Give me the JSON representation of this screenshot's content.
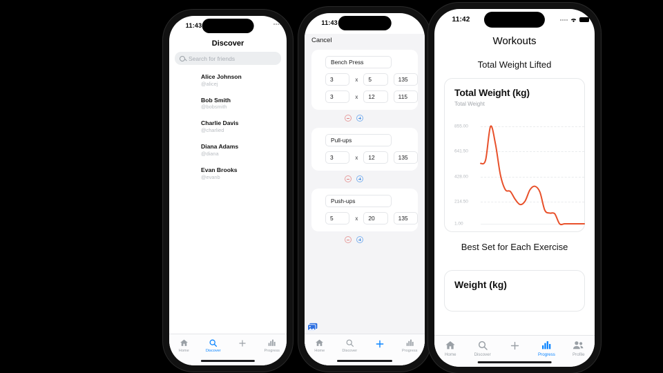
{
  "phones": {
    "discover": {
      "status": {
        "time": "11:43"
      },
      "nav_title": "Discover",
      "search": {
        "placeholder": "Search for friends",
        "icon": "search-icon"
      },
      "friends": [
        {
          "name": "Alice Johnson",
          "handle": "@alicej"
        },
        {
          "name": "Bob Smith",
          "handle": "@bobsmith"
        },
        {
          "name": "Charlie Davis",
          "handle": "@charlied"
        },
        {
          "name": "Diana Adams",
          "handle": "@diana"
        },
        {
          "name": "Evan Brooks",
          "handle": "@evanb"
        }
      ],
      "tabs": [
        {
          "label": "Home",
          "icon": "home-icon",
          "active": false
        },
        {
          "label": "Discover",
          "icon": "search-icon",
          "active": true
        },
        {
          "label": "",
          "icon": "plus-icon",
          "active": false
        },
        {
          "label": "Progress",
          "icon": "bar-chart-icon",
          "active": false
        }
      ]
    },
    "editor": {
      "status": {
        "time": "11:43"
      },
      "cancel_label": "Cancel",
      "overlay_icon": "screenshot-icon",
      "exercises": [
        {
          "name": "Bench Press",
          "sets": [
            {
              "sets": "3",
              "x": "x",
              "reps": "5",
              "weight": "135"
            },
            {
              "sets": "3",
              "x": "x",
              "reps": "12",
              "weight": "115"
            }
          ],
          "controls": {
            "remove": "minus-circle-icon",
            "add": "plus-circle-icon"
          }
        },
        {
          "name": "Pull-ups",
          "sets": [
            {
              "sets": "3",
              "x": "x",
              "reps": "12",
              "weight": "135"
            }
          ],
          "controls": {
            "remove": "minus-circle-icon",
            "add": "plus-circle-icon"
          }
        },
        {
          "name": "Push-ups",
          "sets": [
            {
              "sets": "5",
              "x": "x",
              "reps": "20",
              "weight": "135"
            }
          ],
          "controls": {
            "remove": "minus-circle-icon",
            "add": "plus-circle-icon"
          }
        }
      ],
      "tabs": [
        {
          "label": "Home",
          "icon": "home-icon",
          "active": false
        },
        {
          "label": "Discover",
          "icon": "search-icon",
          "active": false
        },
        {
          "label": "",
          "icon": "plus-icon",
          "active": true
        },
        {
          "label": "Progress",
          "icon": "bar-chart-icon",
          "active": false
        }
      ]
    },
    "progress": {
      "status": {
        "time": "11:42",
        "signal": "signal-icon",
        "wifi": "wifi-icon",
        "battery": "battery-icon"
      },
      "nav_title": "Workouts",
      "section_1_title": "Total Weight Lifted",
      "section_2_title": "Best Set for Each Exercise",
      "card2_title": "Weight (kg)",
      "tabs": [
        {
          "label": "Home",
          "icon": "home-icon",
          "active": false
        },
        {
          "label": "Discover",
          "icon": "search-icon",
          "active": false
        },
        {
          "label": "",
          "icon": "plus-icon",
          "active": false
        },
        {
          "label": "Progress",
          "icon": "bar-chart-icon",
          "active": true
        },
        {
          "label": "Profile",
          "icon": "people-icon",
          "active": false
        }
      ]
    }
  },
  "chart_data": {
    "type": "line",
    "title": "Total Weight (kg)",
    "subtitle": "Total Weight",
    "series": [
      {
        "name": "Total Weight",
        "values": [
          530,
          560,
          855,
          700,
          430,
          300,
          285,
          215,
          170,
          200,
          300,
          330,
          280,
          120,
          95,
          90,
          1,
          1,
          1,
          1,
          1,
          1
        ]
      }
    ],
    "x": [
      0,
      1,
      2,
      3,
      4,
      5,
      6,
      7,
      8,
      9,
      10,
      11,
      12,
      13,
      14,
      15,
      16,
      17,
      18,
      19,
      20,
      21
    ],
    "ytick_labels": [
      "855.00",
      "641.50",
      "428.00",
      "214.50",
      "1.00"
    ],
    "ytick_values": [
      855,
      641.5,
      428,
      214.5,
      1
    ],
    "ylim": [
      1,
      855
    ],
    "xlabel": "",
    "ylabel": "",
    "grid": true,
    "legend": false,
    "line_color": "#E8502A"
  },
  "colors": {
    "accent": "#0a84ff",
    "line": "#E8502A",
    "muted": "#9aa0a6",
    "bezel": "#111111"
  }
}
